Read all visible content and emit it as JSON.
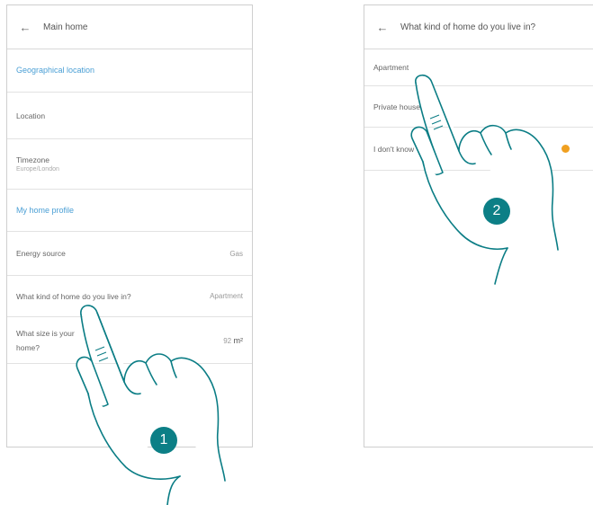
{
  "screen1": {
    "title": "Main home",
    "back_icon": "arrow-left-icon",
    "rows": {
      "geo_header": "Geographical location",
      "location": "Location",
      "timezone": "Timezone",
      "timezone_sub": "Europe/London",
      "profile_header": "My home profile",
      "energy": "Energy source",
      "energy_value": "Gas",
      "kind": "What kind of home do you live in?",
      "kind_value": "Apartment",
      "size_line1": "What size is your",
      "size_line2": "home?",
      "size_value": "92",
      "size_unit": "m²"
    },
    "step": "1"
  },
  "screen2": {
    "title": "What kind of home do you live in?",
    "back_icon": "arrow-left-icon",
    "options": [
      "Apartment",
      "Private house",
      "I don't know"
    ],
    "selected_indicator_color": "#f0a020",
    "step": "2"
  },
  "colors": {
    "accent": "#4a9fd5",
    "step_badge": "#0c7f86",
    "hand_outline": "#0b7d85"
  }
}
